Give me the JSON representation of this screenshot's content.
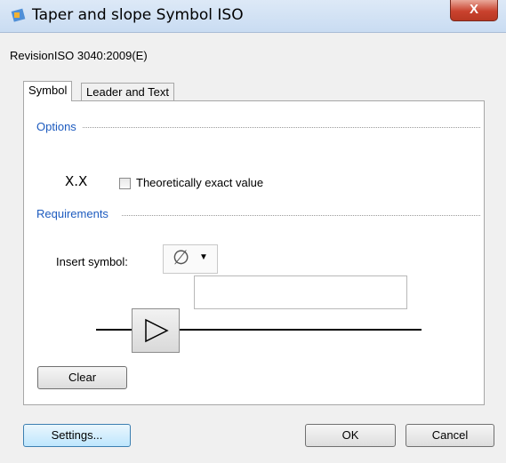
{
  "window": {
    "title": "Taper and slope Symbol ISO",
    "close_label": "X"
  },
  "revision": "RevisionISO 3040:2009(E)",
  "tabs": [
    {
      "label": "Symbol",
      "active": true
    },
    {
      "label": "Leader and Text",
      "active": false
    }
  ],
  "options": {
    "group_title": "Options",
    "symbol_text": "X.X",
    "checkbox_label": "Theoretically exact value",
    "checked": false
  },
  "requirements": {
    "group_title": "Requirements",
    "insert_label": "Insert symbol:",
    "symbol_value": "∅",
    "dropdown_caret": "▼",
    "value_box": ""
  },
  "buttons": {
    "clear": "Clear",
    "settings": "Settings...",
    "ok": "OK",
    "cancel": "Cancel"
  },
  "icons": {
    "app": "app-icon",
    "triangle": "triangle-icon"
  }
}
